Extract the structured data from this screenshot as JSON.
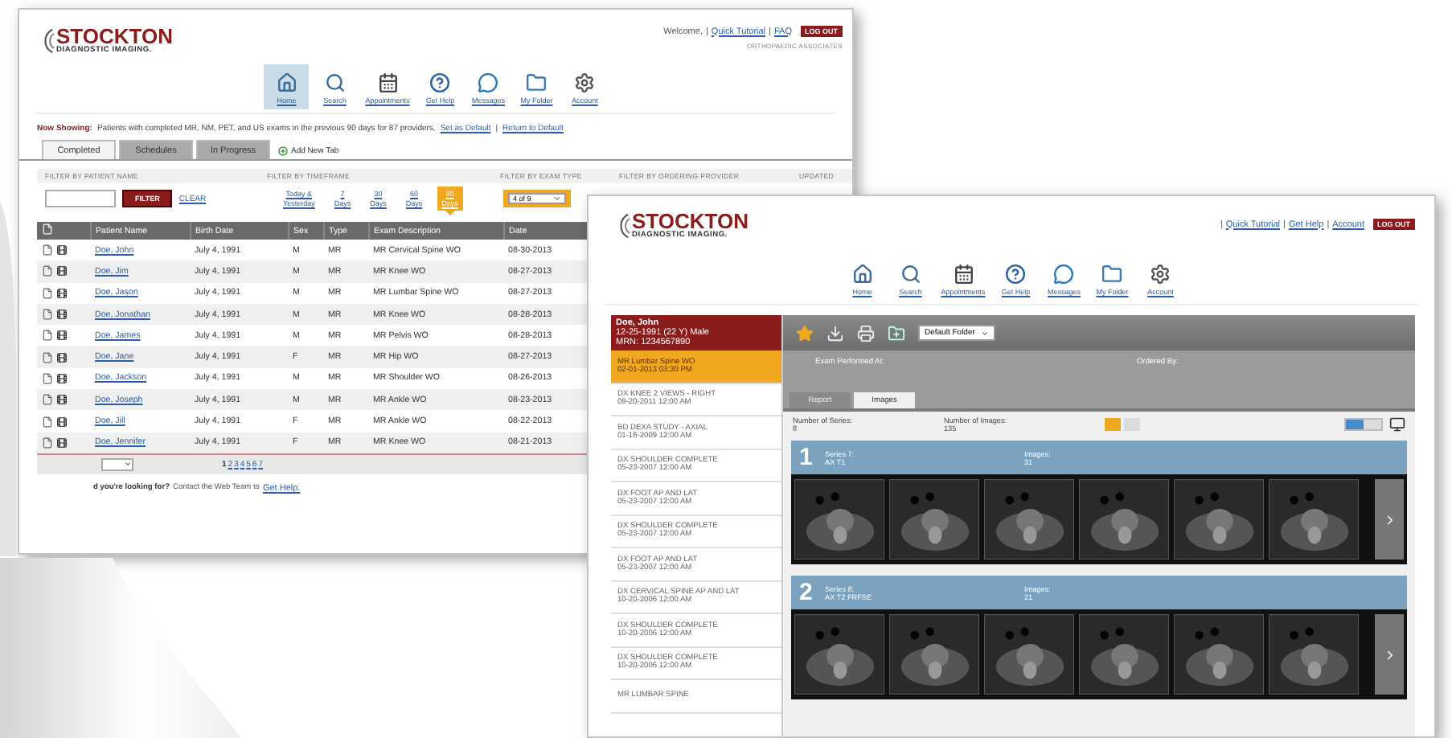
{
  "list_window": {
    "logo": {
      "name": "STOCKTON",
      "tagline": "DIAGNOSTIC IMAGING."
    },
    "welcome": "Welcome,",
    "separator": "|",
    "links": [
      "Quick Tutorial",
      "FAQ"
    ],
    "logout": "LOG OUT",
    "practice": "ORTHOPAEDIC ASSOCIATES",
    "nav": [
      {
        "label": "Home",
        "selected": true
      },
      {
        "label": "Search",
        "selected": false
      },
      {
        "label": "Appointments",
        "selected": false
      },
      {
        "label": "Get Help",
        "selected": false
      },
      {
        "label": "Messages",
        "selected": false
      },
      {
        "label": "My Folder",
        "selected": false
      },
      {
        "label": "Account",
        "selected": false
      }
    ],
    "now_showing": {
      "label": "Now Showing:",
      "text": "Patients with completed MR, NM, PET, and US exams in the previous 90 days for 87 providers.",
      "links": [
        "Set as Default",
        "Return to Default"
      ]
    },
    "tabs": [
      {
        "label": "Completed",
        "selected": true
      },
      {
        "label": "Schedules",
        "selected": false
      },
      {
        "label": "In Progress",
        "selected": false
      }
    ],
    "add_tab": "Add New Tab",
    "filter_labels": [
      "FILTER BY PATIENT NAME",
      "FILTER BY TIMEFRAME",
      "FILTER BY EXAM TYPE",
      "FILTER BY ORDERING PROVIDER",
      "UPDATED"
    ],
    "filter_button": "FILTER",
    "clear": "CLEAR",
    "timeframes": [
      {
        "lines": [
          "Today &",
          "Yesterday"
        ],
        "selected": false
      },
      {
        "lines": [
          "7",
          "Days"
        ],
        "selected": false
      },
      {
        "lines": [
          "30",
          "Days"
        ],
        "selected": false
      },
      {
        "lines": [
          "60",
          "Days"
        ],
        "selected": false
      },
      {
        "lines": [
          "90",
          "Days"
        ],
        "selected": true
      }
    ],
    "exam_type": "4 of 9",
    "table": {
      "columns": [
        "Patient Name",
        "Birth Date",
        "Sex",
        "Type",
        "Exam Description",
        "Date"
      ],
      "rows": [
        [
          "Doe, John",
          "July 4, 1991",
          "M",
          "MR",
          "MR Cervical Spine WO",
          "08-30-2013"
        ],
        [
          "Doe, Jim",
          "July 4, 1991",
          "M",
          "MR",
          "MR Knee WO",
          "08-27-2013"
        ],
        [
          "Doe, Jason",
          "July 4, 1991",
          "M",
          "MR",
          "MR Lumbar Spine WO",
          "08-27-2013"
        ],
        [
          "Doe, Jonathan",
          "July 4, 1991",
          "M",
          "MR",
          "MR Knee WO",
          "08-28-2013"
        ],
        [
          "Doe, James",
          "July 4, 1991",
          "M",
          "MR",
          "MR Pelvis WO",
          "08-28-2013"
        ],
        [
          "Doe, Jane",
          "July 4, 1991",
          "F",
          "MR",
          "MR Hip WO",
          "08-27-2013"
        ],
        [
          "Doe, Jackson",
          "July 4, 1991",
          "M",
          "MR",
          "MR Shoulder WO",
          "08-26-2013"
        ],
        [
          "Doe, Joseph",
          "July 4, 1991",
          "M",
          "MR",
          "MR Ankle WO",
          "08-23-2013"
        ],
        [
          "Doe, Jill",
          "July 4, 1991",
          "F",
          "MR",
          "MR Ankle WO",
          "08-22-2013"
        ],
        [
          "Doe, Jennifer",
          "July 4, 1991",
          "F",
          "MR",
          "MR Knee WO",
          "08-21-2013"
        ]
      ]
    },
    "pages": [
      {
        "label": "1",
        "selected": true
      },
      {
        "label": "2",
        "selected": false
      },
      {
        "label": "3",
        "selected": false
      },
      {
        "label": "4",
        "selected": false
      },
      {
        "label": "5",
        "selected": false
      },
      {
        "label": "6",
        "selected": false
      },
      {
        "label": "7",
        "selected": false
      }
    ],
    "footer": {
      "text": "d you're looking for?",
      "contact": "Contact the Web Team to",
      "link": "Get Help."
    }
  },
  "viewer_window": {
    "logo": {
      "name": "STOCKTON",
      "tagline": "DIAGNOSTIC IMAGING."
    },
    "separator": "|",
    "links": [
      "Quick Tutorial",
      "Get Help",
      "Account"
    ],
    "logout": "LOG OUT",
    "nav": [
      {
        "label": "Home",
        "selected": false
      },
      {
        "label": "Search",
        "selected": false
      },
      {
        "label": "Appointments",
        "selected": false
      },
      {
        "label": "Get Help",
        "selected": false
      },
      {
        "label": "Messages",
        "selected": false
      },
      {
        "label": "My Folder",
        "selected": false
      },
      {
        "label": "Account",
        "selected": false
      }
    ],
    "patient": {
      "name": "Doe, John",
      "details": "12-25-1991 (22 Y) Male",
      "mrn": "MRN: 1234567890"
    },
    "folder_select": "Default Folder",
    "exams": [
      {
        "title": "MR Lumbar Spine WO",
        "date": "02-01-2013 03:30 PM",
        "selected": true
      },
      {
        "title": "DX KNEE 2 VIEWS - RIGHT",
        "date": "09-20-2011 12:00 AM",
        "selected": false
      },
      {
        "title": "BD DEXA STUDY - AXIAL",
        "date": "01-16-2009 12:00 AM",
        "selected": false
      },
      {
        "title": "DX SHOULDER COMPLETE",
        "date": "05-23-2007 12:00 AM",
        "selected": false
      },
      {
        "title": "DX FOOT AP AND LAT",
        "date": "05-23-2007 12:00 AM",
        "selected": false
      },
      {
        "title": "DX SHOULDER COMPLETE",
        "date": "05-23-2007 12:00 AM",
        "selected": false
      },
      {
        "title": "DX FOOT AP AND LAT",
        "date": "05-23-2007 12:00 AM",
        "selected": false
      },
      {
        "title": "DX CERVICAL SPINE AP AND LAT",
        "date": "10-20-2006 12:00 AM",
        "selected": false
      },
      {
        "title": "DX SHOULDER COMPLETE",
        "date": "10-20-2006 12:00 AM",
        "selected": false
      },
      {
        "title": "DX SHOULDER COMPLETE",
        "date": "10-20-2006 12:00 AM",
        "selected": false
      },
      {
        "title": "MR LUMBAR SPINE",
        "selected": false
      }
    ],
    "info": {
      "performed": "Exam Performed At:",
      "ordered": "Ordered By:"
    },
    "tabs": [
      {
        "label": "Report",
        "selected": false
      },
      {
        "label": "Images",
        "selected": true
      }
    ],
    "stats": [
      {
        "label": "Number of Series:",
        "value": "8"
      },
      {
        "label": "Number of Images:",
        "value": "135"
      }
    ],
    "view_modes": [
      {
        "selected": true
      },
      {
        "selected": false
      }
    ],
    "overlay_switch": {
      "on": true
    },
    "series": [
      {
        "number": "1",
        "title": "Series 7:",
        "description": "AX T1",
        "images_label": "Images:",
        "images": "31"
      },
      {
        "number": "2",
        "title": "Series 8:",
        "description": "AX T2 FRFSE",
        "images_label": "Images:",
        "images": "21"
      }
    ]
  }
}
